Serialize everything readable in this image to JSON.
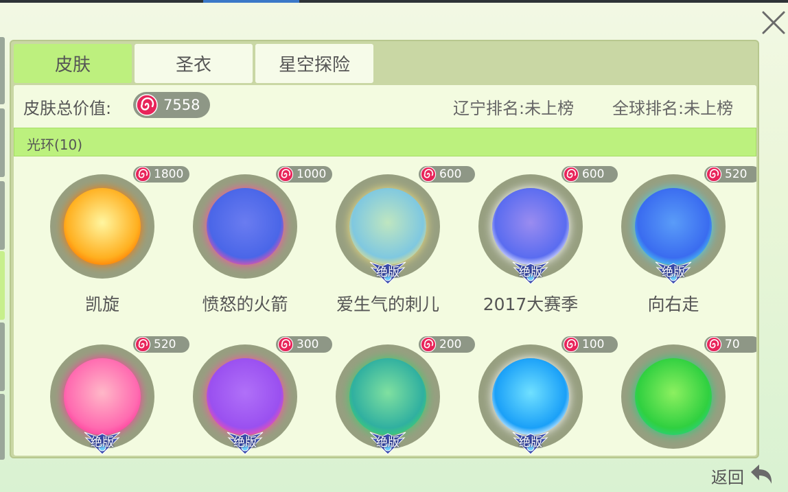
{
  "tabs": [
    {
      "label": "皮肤",
      "active": true
    },
    {
      "label": "圣衣",
      "active": false
    },
    {
      "label": "星空探险",
      "active": false
    }
  ],
  "summary": {
    "value_label": "皮肤总价值:",
    "value_amount": "7558",
    "rank_local": "辽宁排名:未上榜",
    "rank_global": "全球排名:未上榜"
  },
  "category": {
    "label": "光环(10)"
  },
  "items": [
    {
      "name": "凯旋",
      "price": "1800",
      "badge": "",
      "colors": [
        "#fff6a0",
        "#ffb020",
        "#ff7a00"
      ]
    },
    {
      "name": "愤怒的火箭",
      "price": "1000",
      "badge": "",
      "colors": [
        "#6a7cf0",
        "#4a66e8",
        "#ff4fa0"
      ]
    },
    {
      "name": "爱生气的刺儿",
      "price": "600",
      "badge": "绝版",
      "colors": [
        "#bfe6c0",
        "#7fc8e0",
        "#f0e080"
      ]
    },
    {
      "name": "2017大赛季",
      "price": "600",
      "badge": "绝版",
      "colors": [
        "#9a8cf0",
        "#5a6cf0",
        "#ffffff"
      ]
    },
    {
      "name": "向右走",
      "price": "520",
      "badge": "绝版",
      "colors": [
        "#5a9cf8",
        "#3a6cf0",
        "#4ad0f0"
      ]
    },
    {
      "name": "",
      "price": "520",
      "badge": "绝版",
      "colors": [
        "#ffb8c8",
        "#ff6ab0",
        "#ff3c9c"
      ]
    },
    {
      "name": "",
      "price": "300",
      "badge": "绝版",
      "colors": [
        "#b070f8",
        "#9a50f0",
        "#ff50a0"
      ]
    },
    {
      "name": "",
      "price": "200",
      "badge": "绝版",
      "colors": [
        "#80e0a0",
        "#30b0a0",
        "#40d070"
      ]
    },
    {
      "name": "",
      "price": "100",
      "badge": "绝版",
      "colors": [
        "#70e0ff",
        "#1aa0f8",
        "#ffffff"
      ]
    },
    {
      "name": "",
      "price": "70",
      "badge": "",
      "colors": [
        "#8cf060",
        "#30d040",
        "#2ad080"
      ]
    }
  ],
  "footer": {
    "back_label": "返回"
  },
  "icons": {
    "close": "close-icon",
    "currency": "candy-swirl-icon",
    "back": "back-arrow-icon"
  }
}
